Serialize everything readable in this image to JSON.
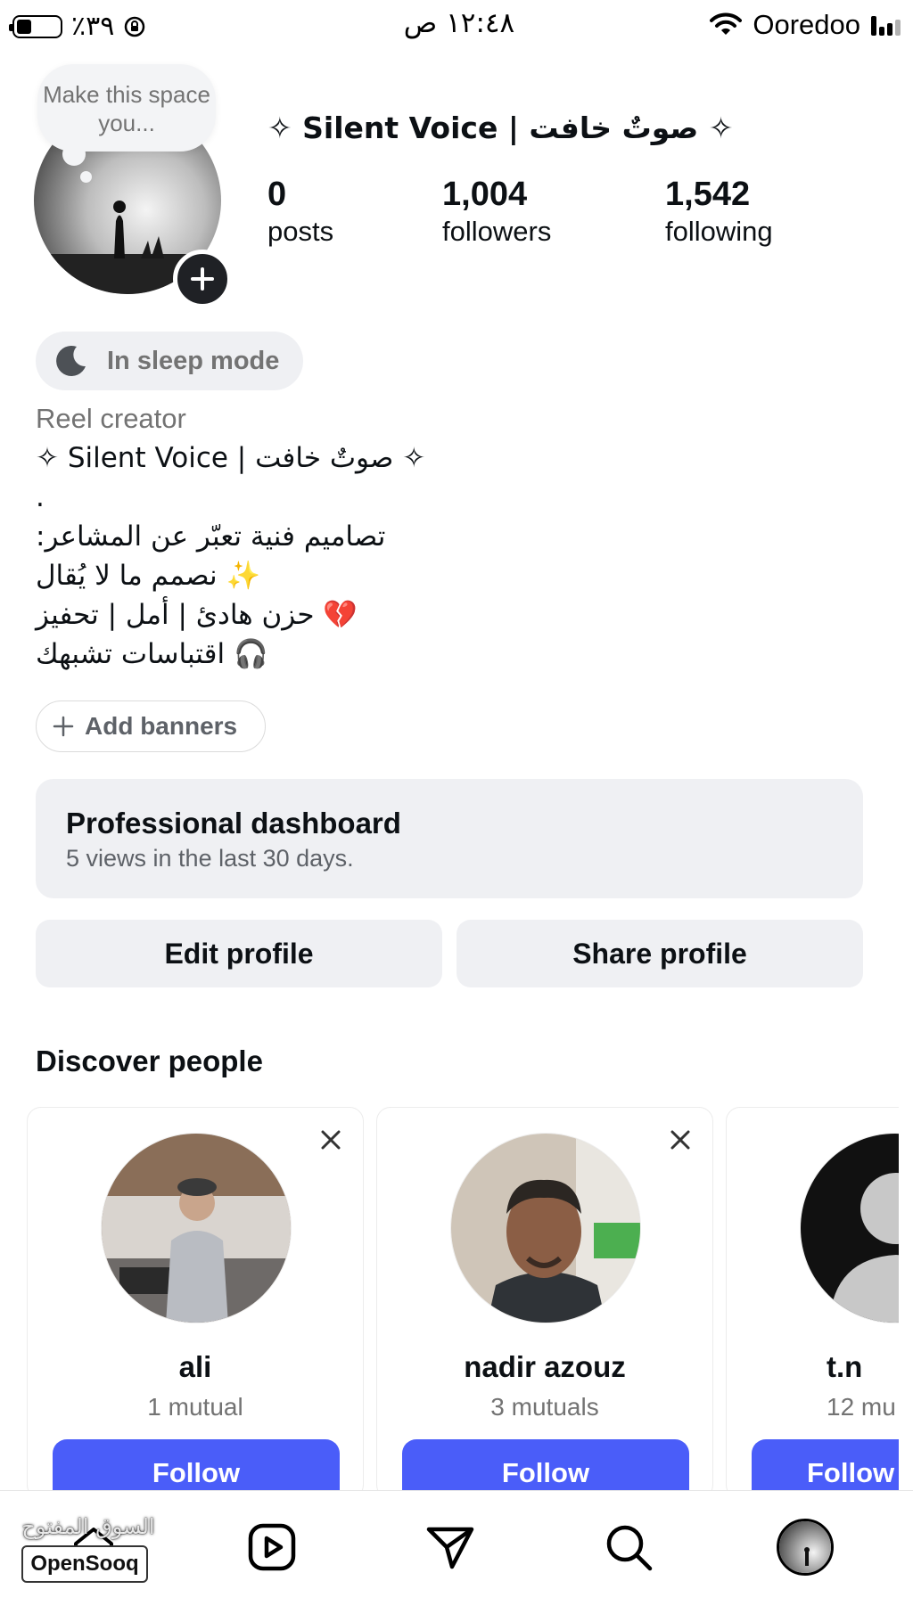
{
  "status_bar": {
    "battery_percent": "٪٣٩",
    "time": "١٢:٤٨ ص",
    "carrier": "Ooredoo"
  },
  "profile": {
    "note_text": "Make this space you...",
    "display_name": "✧ Silent Voice | صوتٌ خافت ✧",
    "stats": [
      {
        "value": "0",
        "label": "posts"
      },
      {
        "value": "1,004",
        "label": "followers"
      },
      {
        "value": "1,542",
        "label": "following"
      }
    ],
    "sleep_mode_label": "In sleep mode",
    "category": "Reel creator",
    "bio_lines": [
      "✧ Silent Voice | صوتٌ خافت ✧",
      ".",
      "تصاميم فنية تعبّر عن المشاعر:",
      "✨ نصمم ما لا يُقال",
      "💔 حزن هادئ | أمل | تحفيز",
      "🎧 اقتباسات تشبهك"
    ],
    "add_banners_label": "Add banners"
  },
  "dashboard": {
    "title": "Professional dashboard",
    "subtitle": "5 views in the last 30 days."
  },
  "actions": {
    "edit_label": "Edit profile",
    "share_label": "Share profile"
  },
  "discover": {
    "title": "Discover people",
    "people": [
      {
        "name": "ali",
        "mutual": "1 mutual",
        "follow_label": "Follow"
      },
      {
        "name": "nadir azouz",
        "mutual": "3 mutuals",
        "follow_label": "Follow"
      },
      {
        "name": "t.n",
        "mutual": "12 mu",
        "follow_label": "Follow"
      }
    ]
  },
  "watermark": {
    "arabic": "السوق المفتوح",
    "brand": "OpenSooq"
  },
  "colors": {
    "follow_blue": "#4a5df9",
    "secondary_text": "#737373",
    "button_gray": "#eff0f3"
  },
  "icons": [
    "battery-icon",
    "orientation-lock-icon",
    "wifi-icon",
    "signal-icon",
    "plus-icon",
    "moon-icon",
    "close-icon",
    "home-icon",
    "reels-icon",
    "direct-icon",
    "search-icon"
  ]
}
